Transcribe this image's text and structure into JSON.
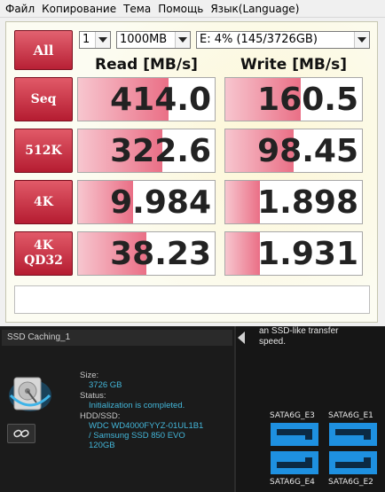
{
  "menu": [
    "Файл",
    "Копирование",
    "Тема",
    "Помощь",
    "Язык(Language)"
  ],
  "controls": {
    "all_label": "All",
    "count": "1",
    "size": "1000MB",
    "drive": "E: 4% (145/3726GB)"
  },
  "headers": {
    "read": "Read [MB/s]",
    "write": "Write [MB/s]"
  },
  "rows": [
    {
      "label": "Seq",
      "label2": "",
      "read": "414.0",
      "write": "160.5",
      "read_fill": 0.66,
      "write_fill": 0.55
    },
    {
      "label": "512K",
      "label2": "",
      "read": "322.6",
      "write": "98.45",
      "read_fill": 0.62,
      "write_fill": 0.5
    },
    {
      "label": "4K",
      "label2": "",
      "read": "9.984",
      "write": "1.898",
      "read_fill": 0.4,
      "write_fill": 0.25
    },
    {
      "label": "4K",
      "label2": "QD32",
      "read": "38.23",
      "write": "1.931",
      "read_fill": 0.5,
      "write_fill": 0.25
    }
  ],
  "caching": {
    "title": "SSD Caching_1",
    "size_label": "Size:",
    "size_value": "3726 GB",
    "status_label": "Status:",
    "status_value": "Initialization is completed.",
    "hdd_label": "HDD/SSD:",
    "hdd_value_1": "WDC WD4000FYYZ-01UL1B1",
    "hdd_value_2": "/ Samsung SSD 850 EVO",
    "hdd_value_3": "120GB"
  },
  "right_panel": {
    "desc_1": "an SSD-like transfer",
    "desc_2": "speed.",
    "ports": [
      "SATA6G_E3",
      "SATA6G_E1",
      "SATA6G_E4",
      "SATA6G_E2"
    ]
  },
  "colors": {
    "accent_red": "#c02a3c",
    "port_blue": "#1e90e0",
    "info_blue": "#43b6d9"
  }
}
